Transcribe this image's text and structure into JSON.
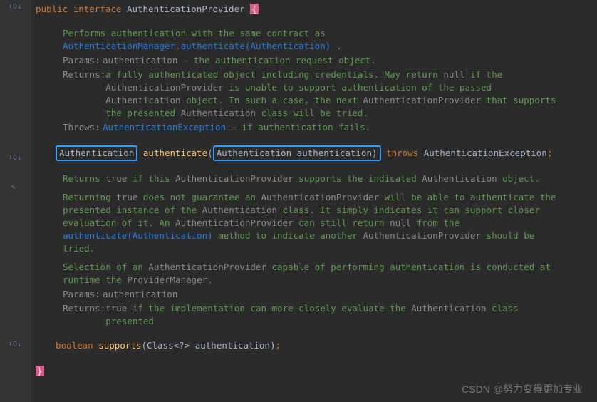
{
  "declaration": {
    "public": "public",
    "interface": "interface",
    "name": "AuthenticationProvider",
    "open_brace": "{",
    "close_brace": "}"
  },
  "method1_doc": {
    "summary_prefix": "Performs authentication with the same contract as ",
    "summary_link": "AuthenticationManager.authenticate(Authentication)",
    "summary_suffix": " .",
    "params_label": "Params:",
    "params_name": "authentication",
    "params_desc": " – the authentication request object.",
    "returns_label": "Returns:",
    "returns_text1": "a fully authenticated object including credentials. May return ",
    "returns_null": "null",
    "returns_text2": " if the ",
    "returns_ref1": "AuthenticationProvider",
    "returns_text3": " is unable to support authentication of the passed ",
    "returns_ref2": "Authentication",
    "returns_text4": " object. In such a case, the next ",
    "returns_ref3": "AuthenticationProvider",
    "returns_text5": " that supports the presented ",
    "returns_ref4": "Authentication",
    "returns_text6": " class will be tried.",
    "throws_label": "Throws:",
    "throws_link": "AuthenticationException",
    "throws_desc": " – if authentication fails."
  },
  "method1_sig": {
    "return_type": "Authentication",
    "name": "authenticate",
    "param_type": "Authentication",
    "param_name": "authentication",
    "throws_kw": "throws",
    "exception": "AuthenticationException"
  },
  "method2_doc": {
    "line1_a": "Returns ",
    "line1_true": "true",
    "line1_b": " if this ",
    "line1_ref1": "AuthenticationProvider",
    "line1_c": " supports the indicated ",
    "line1_ref2": "Authentication",
    "line1_d": " object.",
    "line2_a": "Returning ",
    "line2_true": "true",
    "line2_b": " does not guarantee an ",
    "line2_ref1": "AuthenticationProvider",
    "line2_c": " will be able to authenticate the presented instance of the ",
    "line2_ref2": "Authentication",
    "line2_d": " class. It simply indicates it can support closer evaluation of it. An ",
    "line2_ref3": "AuthenticationProvider",
    "line2_e": " can still return ",
    "line2_null": "null",
    "line2_f": " from the ",
    "line2_link": "authenticate(Authentication)",
    "line2_g": " method to indicate another ",
    "line2_ref4": "AuthenticationProvider",
    "line2_h": " should be tried.",
    "line3_a": "Selection of an ",
    "line3_ref1": "AuthenticationProvider",
    "line3_b": " capable of performing authentication is conducted at runtime the ",
    "line3_ref2": "ProviderManager",
    "line3_c": ".",
    "params_label": "Params:",
    "params_name": "authentication",
    "returns_label": "Returns:",
    "returns_a": "true",
    "returns_b": " if the implementation can more closely evaluate the ",
    "returns_ref": "Authentication",
    "returns_c": " class presented"
  },
  "method2_sig": {
    "return_type": "boolean",
    "name": "supports",
    "param_type": "Class<?>",
    "param_name": "authentication"
  },
  "watermark": "CSDN @努力变得更加专业"
}
